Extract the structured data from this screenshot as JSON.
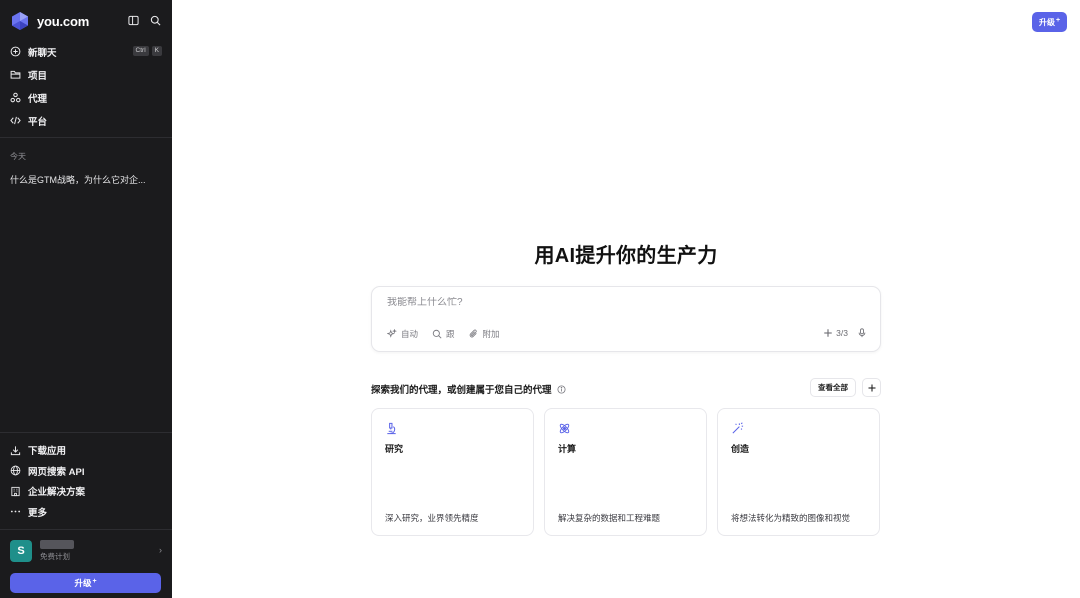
{
  "sidebar": {
    "brand": "you.com",
    "icons": [
      "sidebar-toggle-icon",
      "search-icon"
    ],
    "nav": [
      {
        "label": "新聊天",
        "icon": "plus-circle-icon",
        "shortcut": [
          "Ctrl",
          "K"
        ]
      },
      {
        "label": "项目",
        "icon": "folder-icon"
      },
      {
        "label": "代理",
        "icon": "agents-icon"
      },
      {
        "label": "平台",
        "icon": "code-icon"
      }
    ],
    "history_group": "今天",
    "history": [
      "什么是GTM战略，为什么它对企..."
    ],
    "bottom_nav": [
      {
        "label": "下载应用",
        "icon": "download-icon"
      },
      {
        "label": "网页搜索 API",
        "icon": "globe-icon"
      },
      {
        "label": "企业解决方案",
        "icon": "building-icon"
      },
      {
        "label": "更多",
        "icon": "more-icon"
      }
    ],
    "user": {
      "initial": "S",
      "plan": "免费计划"
    },
    "upgrade_label": "升级"
  },
  "header": {
    "upgrade_label": "升级"
  },
  "main": {
    "headline": "用AI提升你的生产力",
    "prompt": {
      "placeholder": "我能帮上什么忙?",
      "tools": [
        {
          "label": "自动",
          "icon": "sparkle-icon"
        },
        {
          "label": "跟",
          "icon": "search-icon"
        },
        {
          "label": "附加",
          "icon": "paperclip-icon"
        }
      ],
      "counter": "3/3"
    },
    "agents": {
      "title": "探索我们的代理，或创建属于您自己的代理",
      "view_all": "查看全部",
      "cards": [
        {
          "title": "研究",
          "desc": "深入研究，业界领先精度",
          "icon": "microscope-icon"
        },
        {
          "title": "计算",
          "desc": "解决复杂的数据和工程难题",
          "icon": "atom-icon"
        },
        {
          "title": "创造",
          "desc": "将想法转化为精致的图像和视觉",
          "icon": "magic-wand-icon"
        }
      ]
    }
  },
  "colors": {
    "accent": "#5a63e8",
    "sidebar_bg": "#1b1b1d"
  }
}
